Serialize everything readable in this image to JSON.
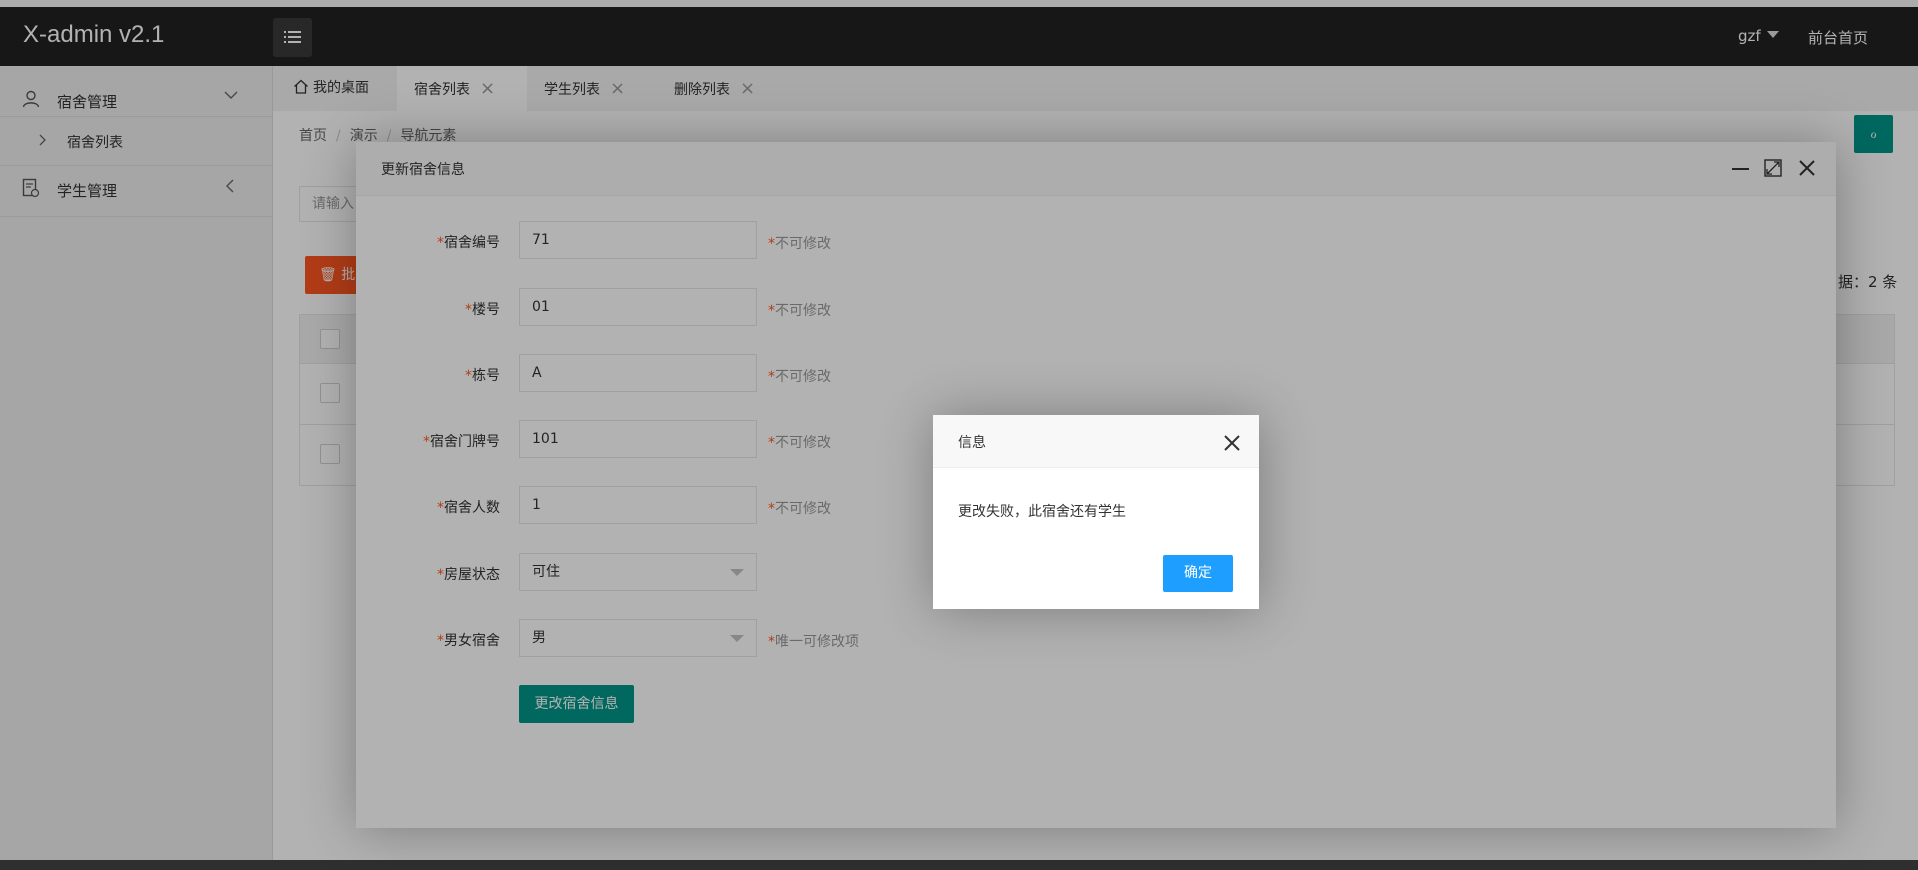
{
  "app": {
    "title": "X-admin v2.1"
  },
  "header": {
    "user": "gzf",
    "front_link": "前台首页"
  },
  "sidebar": {
    "groups": [
      {
        "label": "宿舍管理",
        "icon": "user-icon",
        "expanded": true,
        "children": [
          {
            "label": "宿舍列表"
          }
        ]
      },
      {
        "label": "学生管理",
        "icon": "document-icon",
        "expanded": false
      }
    ]
  },
  "tabs": [
    {
      "label": "我的桌面",
      "icon": "home-icon",
      "closable": false,
      "active": false
    },
    {
      "label": "宿舍列表",
      "closable": true,
      "active": true
    },
    {
      "label": "学生列表",
      "closable": true,
      "active": false
    },
    {
      "label": "删除列表",
      "closable": true,
      "active": false
    }
  ],
  "page": {
    "breadcrumb": [
      "首页",
      "演示",
      "导航元素"
    ],
    "refresh_glyph": "ℴ",
    "search_placeholder": "请输入",
    "batch_delete_label": "批",
    "total_text": "据：2 条"
  },
  "edit_layer": {
    "title": "更新宿舍信息",
    "fields": [
      {
        "label": "宿舍编号",
        "value": "71",
        "hint": "不可修改",
        "type": "input"
      },
      {
        "label": "楼号",
        "value": "01",
        "hint": "不可修改",
        "type": "input"
      },
      {
        "label": "栋号",
        "value": "A",
        "hint": "不可修改",
        "type": "input"
      },
      {
        "label": "宿舍门牌号",
        "value": "101",
        "hint": "不可修改",
        "type": "input"
      },
      {
        "label": "宿舍人数",
        "value": "1",
        "hint": "不可修改",
        "type": "input"
      },
      {
        "label": "房屋状态",
        "value": "可住",
        "hint": "",
        "type": "select"
      },
      {
        "label": "男女宿舍",
        "value": "男",
        "hint": "唯一可修改项",
        "type": "select"
      }
    ],
    "required_mark": "*",
    "submit_label": "更改宿舍信息"
  },
  "dialog": {
    "title": "信息",
    "message": "更改失败，此宿舍还有学生",
    "ok_label": "确定"
  },
  "colors": {
    "topbar": "#222222",
    "accent_teal": "#009688",
    "danger_orange": "#ff5722",
    "primary_blue": "#1e9fff"
  }
}
